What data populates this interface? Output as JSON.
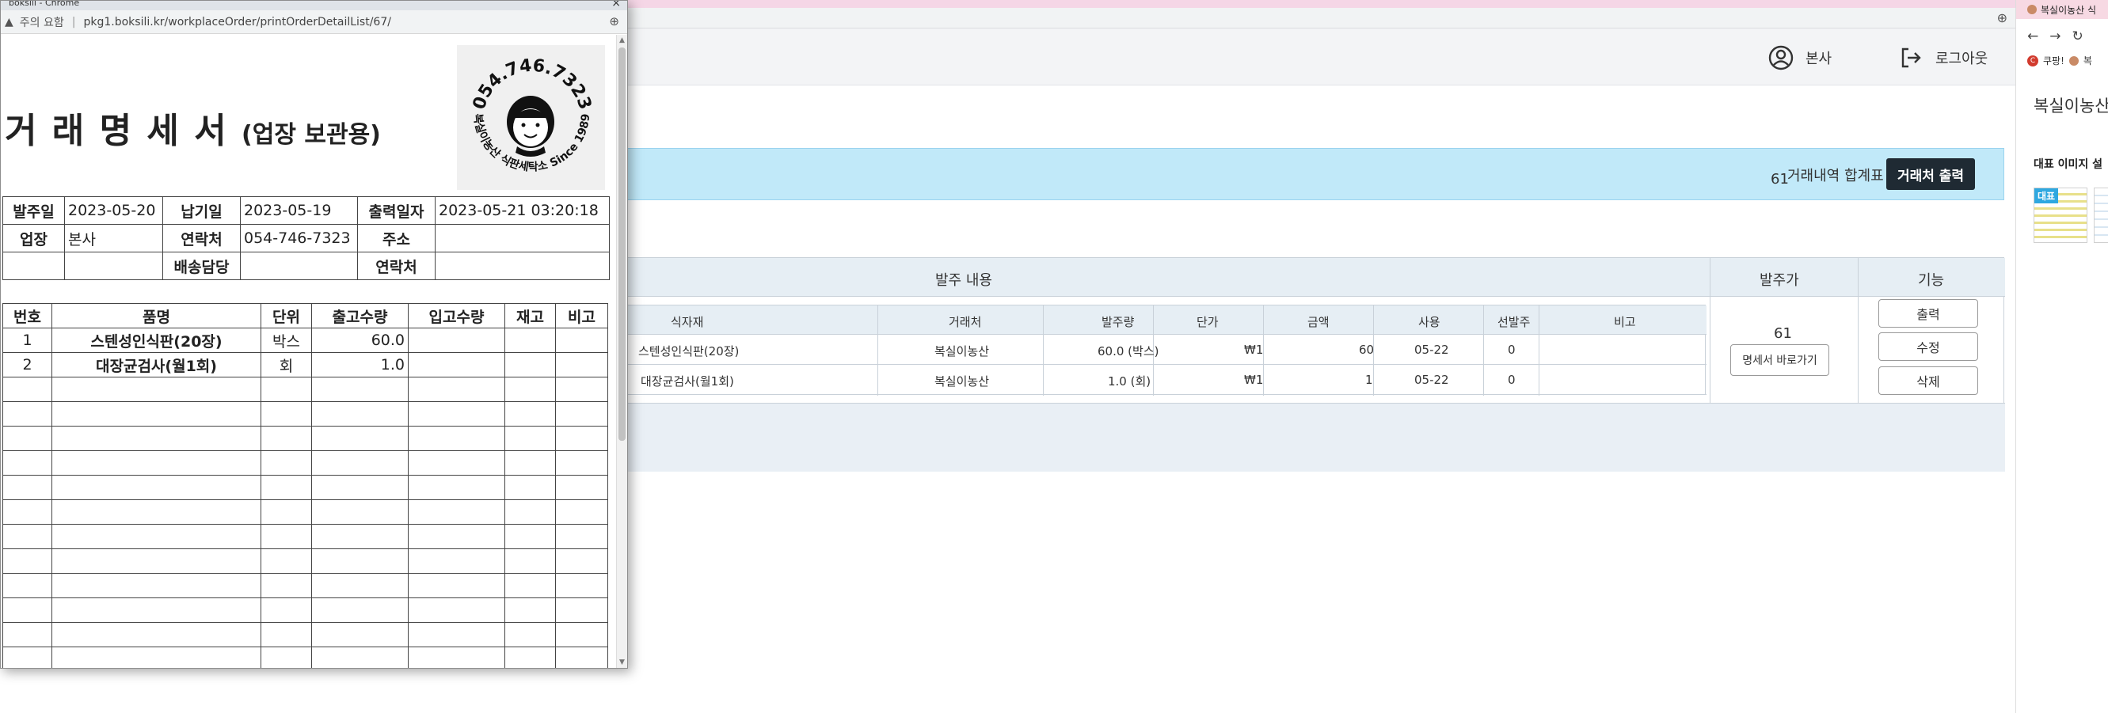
{
  "popup": {
    "window_title": "boksili - Chrome",
    "address_warning": "주의 요함",
    "url": "pkg1.boksili.kr/workplaceOrder/printOrderDetailList/67/",
    "doc_title": "거 래 명 세 서",
    "doc_title_sub": "(업장 보관용)",
    "stamp": {
      "phone": "054.746.7323",
      "tagline": "복실이농산 식판세탁소 Since 1989"
    },
    "info": {
      "order_date_label": "발주일",
      "order_date": "2023-05-20",
      "delivery_date_label": "납기일",
      "delivery_date": "2023-05-19",
      "print_date_label": "출력일자",
      "print_date": "2023-05-21 03:20:18",
      "site_label": "업장",
      "site": "본사",
      "contact_label": "연락처",
      "contact": "054-746-7323",
      "address_label": "주소",
      "address": "",
      "delivery_person_label": "배송담당",
      "delivery_person": "",
      "contact2_label": "연락처",
      "contact2": ""
    },
    "items_headers": [
      "번호",
      "품명",
      "단위",
      "출고수량",
      "입고수량",
      "재고",
      "비고"
    ],
    "items": [
      {
        "no": "1",
        "name": "스텐성인식판(20장)",
        "unit": "박스",
        "out_qty": "60.0",
        "in_qty": "",
        "stock": "",
        "note": ""
      },
      {
        "no": "2",
        "name": "대장균검사(월1회)",
        "unit": "회",
        "out_qty": "1.0",
        "in_qty": "",
        "stock": "",
        "note": ""
      }
    ]
  },
  "header": {
    "user_label": "본사",
    "logout_label": "로그아웃"
  },
  "summary": {
    "label": "거래내역 합계표",
    "print_button": "거래처 출력"
  },
  "order_table": {
    "headers": {
      "content": "발주 내용",
      "price": "발주가",
      "function": "기능"
    },
    "inner_headers": [
      "식자재",
      "거래처",
      "발주량",
      "단가",
      "금액",
      "사용",
      "선발주",
      "비고"
    ],
    "inner_rows": [
      {
        "item": "스텐성인식판(20장)",
        "vendor": "복실이농산",
        "qty": "60.0 (박스)",
        "unit_price": "₩1",
        "amount": "60",
        "use": "05-22",
        "pre_order": "0",
        "note": ""
      },
      {
        "item": "대장균검사(월1회)",
        "vendor": "복실이농산",
        "qty": "1.0 (회)",
        "unit_price": "₩1",
        "amount": "1",
        "use": "05-22",
        "pre_order": "0",
        "note": ""
      }
    ],
    "price_value": "61",
    "go_statement_button": "명세서 바로가기",
    "print_button": "출력",
    "edit_button": "수정",
    "delete_button": "삭제",
    "total_value": "61"
  },
  "side": {
    "tab_title": "복실이농산 식",
    "bookmark1": "쿠팡!",
    "bookmark2": "복",
    "title": "복실이농산",
    "subtitle": "대표 이미지 설",
    "thumb_badge": "대표"
  },
  "colors": {
    "summary_bg": "#c1e9f9",
    "dark_button": "#1f2a33",
    "table_header_bg": "#e6eef4"
  }
}
